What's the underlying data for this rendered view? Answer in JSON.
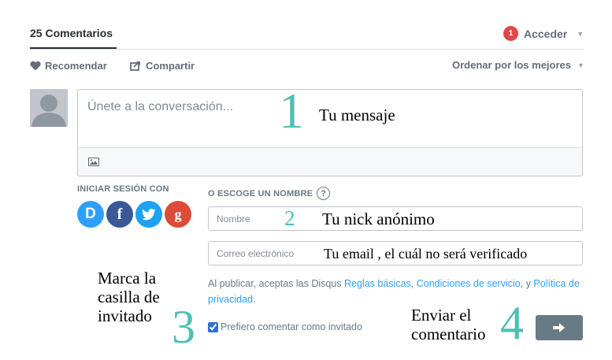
{
  "header": {
    "comments_tab": "25 Comentarios",
    "notification_count": "1",
    "login_label": "Acceder"
  },
  "actions": {
    "recommend_label": "Recomendar",
    "share_label": "Compartir",
    "sort_label": "Ordenar por los mejores"
  },
  "composer": {
    "placeholder": "Únete a la conversación..."
  },
  "login": {
    "social_title": "INICIAR SESIÓN CON",
    "providers": [
      "D",
      "f",
      "t",
      "g"
    ],
    "name_title": "O ESCOGE UN NOMBRE",
    "help_glyph": "?",
    "name_placeholder": "Nombre",
    "email_placeholder": "Correo electrónico"
  },
  "terms": {
    "prefix": "Al publicar, aceptas las Disqus ",
    "link1": "Reglas básicas",
    "sep1": ", ",
    "link2": "Condiciones de servicio",
    "sep2": ", y ",
    "link3": "Política de privacidad",
    "suffix": "."
  },
  "guest": {
    "label": "Prefiero comentar como invitado",
    "checked": true
  },
  "annotations": {
    "n1": "1",
    "a1": "Tu mensaje",
    "n2": "2",
    "a2": "Tu nick anónimo",
    "email": "Tu email ,  el cuál no será verificado",
    "a3": "Marca la casilla de invitado",
    "n3": "3",
    "a4": "Enviar el comentario",
    "n4": "4"
  },
  "colors": {
    "accent": "#2e9fff",
    "annotation_number": "#4fbfb4",
    "badge": "#e3464a",
    "submit": "#687a86"
  },
  "icons": [
    "heart-icon",
    "share-icon",
    "chevron-down-icon",
    "image-icon",
    "help-icon",
    "arrow-right-icon"
  ]
}
